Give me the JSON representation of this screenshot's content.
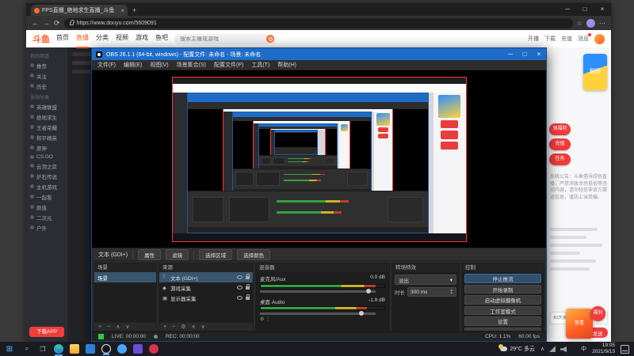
{
  "browser": {
    "tab_title": "FPS直播_绝地求生直播_斗鱼",
    "tab_close": "×",
    "new_tab": "+",
    "min": "─",
    "max": "□",
    "close": "×",
    "back": "←",
    "forward": "→",
    "refresh": "⟳",
    "url": "https://www.douyu.com/5609091",
    "star": "☆",
    "menu": "⋯"
  },
  "douyu": {
    "logo": "斗鱼",
    "nav": [
      "首页",
      "直播",
      "分类",
      "视频",
      "游戏",
      "鱼吧"
    ],
    "search_placeholder": "搜索主播或游戏",
    "actions": [
      "开播",
      "下载",
      "充值",
      "消息"
    ],
    "sidebar": {
      "sec1": "我的频道",
      "sec1_items": [
        "推荐",
        "关注",
        "历史"
      ],
      "sec2": "全站分类",
      "sec2_items": [
        "英雄联盟",
        "绝地求生",
        "王者荣耀",
        "和平精英",
        "原神",
        "CS:GO",
        "云顶之弈",
        "炉石传说",
        "主机游戏",
        "一起看",
        "颜值",
        "二次元",
        "户外"
      ],
      "bottom": "下载APP"
    },
    "chat": {
      "mascot": "翻牌",
      "pills": [
        "领福利",
        "充值",
        "任务"
      ],
      "notice": "系统公告：斗鱼倡导绿色直播，严禁涉政涉恐低俗等违规内容，请勿轻信非官方渠道信息，谨防上当受骗。",
      "input_placeholder": "和大家聊点什么吧…",
      "send": "发送"
    },
    "float_mascot": "惊喜",
    "float_badge": "福利"
  },
  "obs": {
    "title": "OBS 26.1.1 (64-bit, windows) - 配置文件: 未命名 - 场景: 未命名",
    "min": "─",
    "max": "□",
    "close": "×",
    "menu": [
      "文件(F)",
      "编辑(E)",
      "视图(V)",
      "场景集合(S)",
      "配置文件(P)",
      "工具(T)",
      "帮助(H)"
    ],
    "srcbar": {
      "selected": "文本 (GDI+)",
      "btn_props": "属性",
      "btn_filters": "滤镜",
      "btn_region": "选择区域",
      "btn_color": "选择颜色"
    },
    "scenes": {
      "title": "场景",
      "item": "场景",
      "tools": [
        "+",
        "−",
        "∧",
        "∨"
      ]
    },
    "sources": {
      "title": "来源",
      "items": [
        {
          "icon": "T",
          "label": "文本 (GDI+)"
        },
        {
          "icon": "◆",
          "label": "游戏采集"
        },
        {
          "icon": "▣",
          "label": "显示器采集"
        }
      ],
      "tools": [
        "+",
        "−",
        "⚙",
        "∧",
        "∨"
      ]
    },
    "mixer": {
      "title": "混音器",
      "ch": [
        {
          "name": "麦克风/Aux",
          "db": "0.0 dB"
        },
        {
          "name": "桌面 Audio",
          "db": "-1.9 dB"
        }
      ],
      "ch_icons": "⚙ ⋮"
    },
    "transitions": {
      "title": "转场特效",
      "selected": "淡出",
      "caret": "▾",
      "dur_label": "时长",
      "dur": "300 ms"
    },
    "controls": {
      "title": "控制",
      "buttons": [
        "停止推流",
        "开始录制",
        "启动虚拟摄像机",
        "工作室模式",
        "设置",
        "退出"
      ]
    },
    "status": {
      "live": "LIVE: 00:00:00",
      "rec": "REC: 00:00:00",
      "cpu": "CPU: 1.1%",
      "fps": "60.00 fps"
    }
  },
  "taskbar": {
    "weather": "29°C 多云",
    "tray_expand": "∧",
    "ime": "中",
    "time": "19:05",
    "date": "2021/9/13"
  }
}
